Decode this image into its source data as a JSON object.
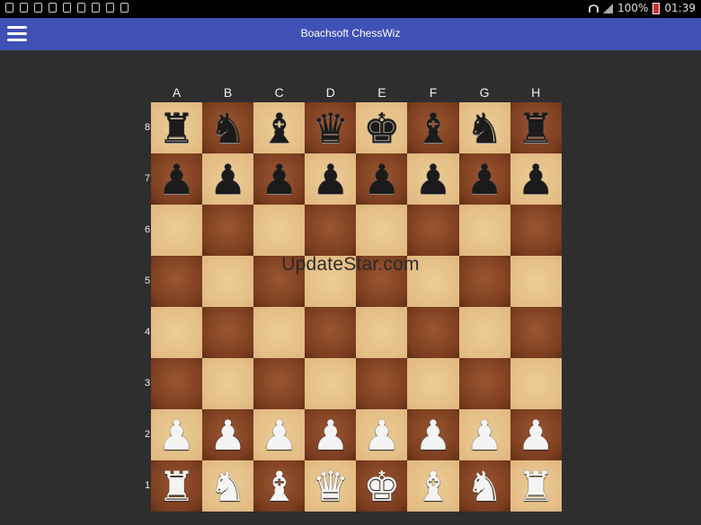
{
  "status_bar": {
    "battery": "100%",
    "time": "01:39"
  },
  "app_bar": {
    "title": "Boachsoft ChessWiz"
  },
  "board": {
    "files": [
      "A",
      "B",
      "C",
      "D",
      "E",
      "F",
      "G",
      "H"
    ],
    "ranks": [
      "8",
      "7",
      "6",
      "5",
      "4",
      "3",
      "2",
      "1"
    ],
    "rows": [
      [
        "bR",
        "bN",
        "bB",
        "bQ",
        "bK",
        "bB",
        "bN",
        "bR"
      ],
      [
        "bP",
        "bP",
        "bP",
        "bP",
        "bP",
        "bP",
        "bP",
        "bP"
      ],
      [
        "",
        "",
        "",
        "",
        "",
        "",
        "",
        ""
      ],
      [
        "",
        "",
        "",
        "",
        "",
        "",
        "",
        ""
      ],
      [
        "",
        "",
        "",
        "",
        "",
        "",
        "",
        ""
      ],
      [
        "",
        "",
        "",
        "",
        "",
        "",
        "",
        ""
      ],
      [
        "wP",
        "wP",
        "wP",
        "wP",
        "wP",
        "wP",
        "wP",
        "wP"
      ],
      [
        "wR",
        "wN",
        "wB",
        "wQ",
        "wK",
        "wB",
        "wN",
        "wR"
      ]
    ],
    "colors": {
      "light": "#e5c08a",
      "dark": "#8a4726"
    }
  },
  "watermark": "UpdateStar.com"
}
